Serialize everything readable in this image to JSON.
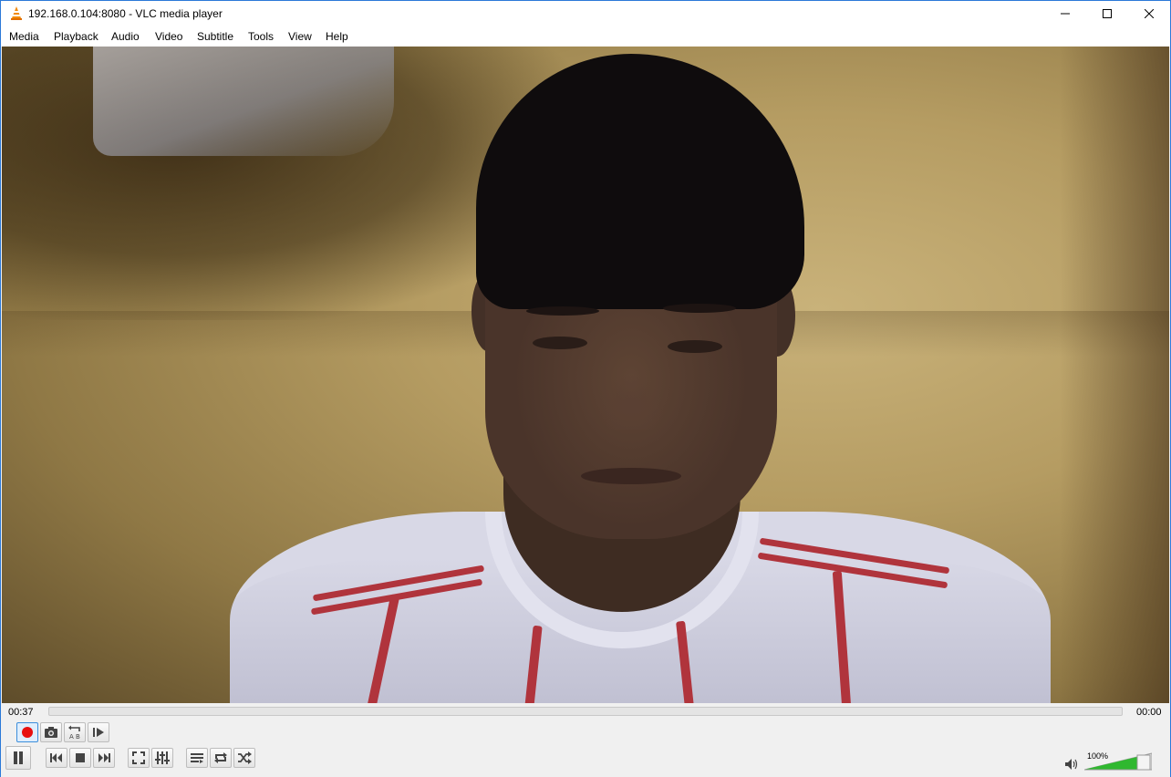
{
  "window": {
    "title": "192.168.0.104:8080 - VLC media player"
  },
  "menu": {
    "items": [
      "Media",
      "Playback",
      "Audio",
      "Video",
      "Subtitle",
      "Tools",
      "View",
      "Help"
    ]
  },
  "playback": {
    "elapsed": "00:37",
    "total": "00:00",
    "progress": 0.0
  },
  "toolbar_top": {
    "buttons": [
      "record-icon",
      "snapshot-icon",
      "loop-ab-icon",
      "frame-step-icon"
    ]
  },
  "toolbar_bottom": {
    "buttons": [
      "pause-icon",
      "previous-icon",
      "stop-icon",
      "next-icon",
      "fullscreen-icon",
      "extended-settings-icon",
      "playlist-icon",
      "loop-icon",
      "shuffle-icon"
    ]
  },
  "volume": {
    "level_label": "100%",
    "level": 1.0,
    "accent": "#2fb82f"
  },
  "colors": {
    "window_border": "#2b79d8",
    "record_red": "#e81010",
    "active_button": "#3c8edb"
  }
}
